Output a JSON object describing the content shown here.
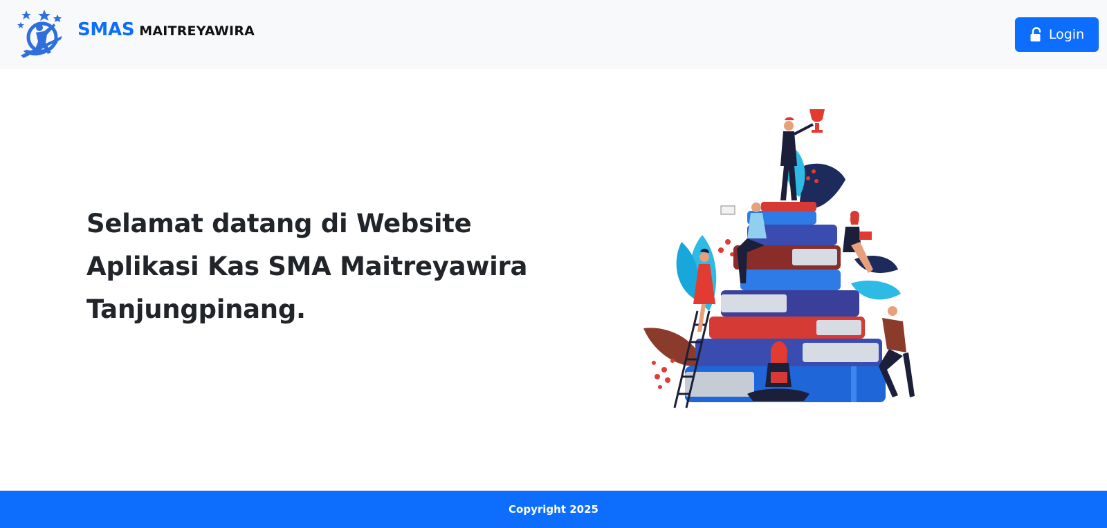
{
  "header": {
    "brand_primary": "SMAS",
    "brand_secondary": "MAITREYAWIRA",
    "logo_icon": "school-logo-icon",
    "login_icon": "unlock-icon",
    "login_label": "Login"
  },
  "hero": {
    "headline": "Selamat datang di Website Aplikasi Kas SMA Maitreyawira Tanjungpinang.",
    "illustration": "books-stack-illustration"
  },
  "footer": {
    "copyright": "Copyright 2025"
  },
  "colors": {
    "primary": "#0d6efd",
    "navbar_bg": "#f8f9fa",
    "text_dark": "#212529"
  }
}
